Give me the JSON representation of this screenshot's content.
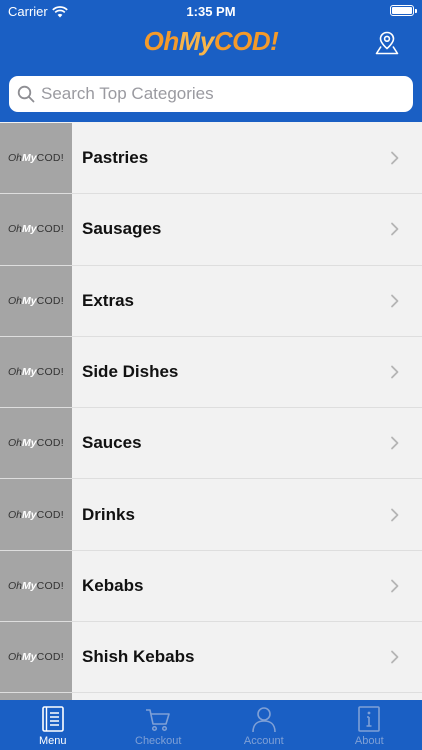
{
  "status": {
    "carrier": "Carrier",
    "time": "1:35 PM"
  },
  "brand": {
    "oh": "Oh",
    "my": "My",
    "cod": "COD!"
  },
  "search": {
    "placeholder": "Search Top Categories"
  },
  "thumb_text": {
    "oh": "Oh",
    "my": "My",
    "cod": "COD!"
  },
  "categories": [
    {
      "label": "Pastries"
    },
    {
      "label": "Sausages"
    },
    {
      "label": "Extras"
    },
    {
      "label": "Side Dishes"
    },
    {
      "label": "Sauces"
    },
    {
      "label": "Drinks"
    },
    {
      "label": "Kebabs"
    },
    {
      "label": "Shish Kebabs"
    }
  ],
  "tabs": [
    {
      "label": "Menu",
      "icon": "menu-book-icon",
      "active": true
    },
    {
      "label": "Checkout",
      "icon": "cart-icon",
      "active": false
    },
    {
      "label": "Account",
      "icon": "user-icon",
      "active": false
    },
    {
      "label": "About",
      "icon": "info-icon",
      "active": false
    }
  ],
  "colors": {
    "accent": "#1a5fc4",
    "brand_orange": "#f49a2a",
    "thumb_gray": "#a5a5a5"
  }
}
